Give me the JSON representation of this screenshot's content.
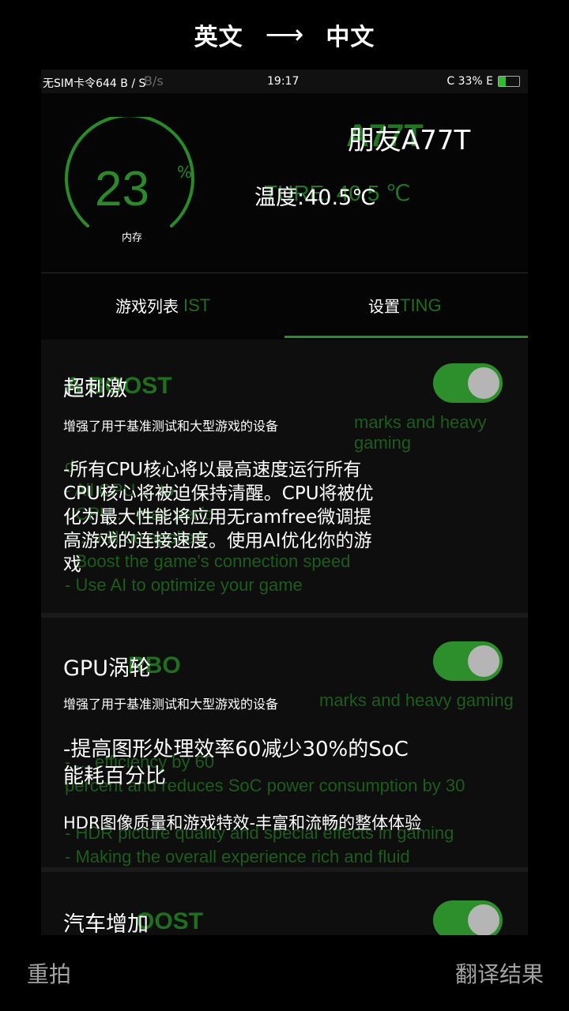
{
  "translator": {
    "source_lang": "英文",
    "arrow": "⟶",
    "target_lang": "中文",
    "retake_label": "重拍",
    "result_label": "翻译结果"
  },
  "status": {
    "left_text": "无SIM卡令644 B / S",
    "ghost_speed": "B/s",
    "time": "19:17",
    "right_text": "C 33% E",
    "battery_level": 0.33
  },
  "gauge": {
    "value": "23",
    "unit": "%",
    "label": "内存",
    "fill_fraction": 0.23,
    "color": "#2a8a2a"
  },
  "device": {
    "ghost_name": "A77T",
    "name": "朋友A77T",
    "ghost_temp": "TURE: 40.5 ℃",
    "temp": "温度:40.5℃"
  },
  "tabs": [
    {
      "ghost": "IST",
      "label": "游戏列表",
      "selected": false
    },
    {
      "ghost": "TING",
      "label": "设置",
      "selected": true
    }
  ],
  "cards": [
    {
      "ghost_title": "A BOOST",
      "title": "超刺激",
      "ghost_sub": "marks and heavy gaming",
      "sub": "增强了用于基准测试和大型游戏的设备",
      "ghost_body": "d\n- All CPU ... to\n- CPU ... max perfo\n- ... will be applied\n- Boost the game's connection speed\n- Use AI to optimize your game",
      "body": "-所有CPU核心将以最高速度运行所有\nCPU核心将被迫保持清醒。CPU将被优\n化为最大性能将应用无ramfree微调提\n高游戏的连接速度。使用AI优化你的游\n戏",
      "toggle_on": true
    },
    {
      "ghost_title": "RBO",
      "title": "GPU涡轮",
      "ghost_sub": "marks and heavy gaming",
      "sub": "增强了用于基准测试和大型游戏的设备",
      "ghost_body": "- ... efficiency by 60\npercent and reduces SoC power consumption by 30\n\n- HDR picture quality and special effects in gaming\n- Making the overall experience rich and fluid",
      "body_main": "-提高图形处理效率60减少30%的SoC\n能耗百分比",
      "body_extra": "HDR图像质量和游戏特效-丰富和流畅的整体体验",
      "toggle_on": true
    },
    {
      "ghost_title": "OOST",
      "title": "汽车增加",
      "toggle_on": true
    }
  ]
}
